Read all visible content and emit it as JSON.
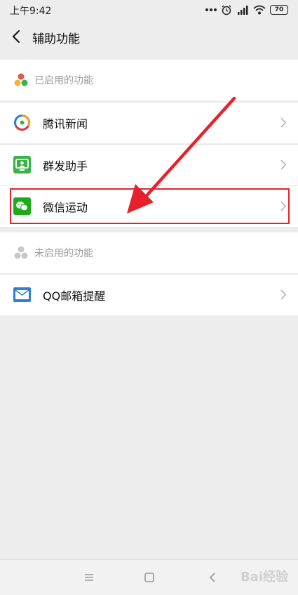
{
  "status_bar": {
    "time": "上午9:42",
    "battery": "70"
  },
  "nav": {
    "title": "辅助功能"
  },
  "enabled_section": {
    "label": "已启用的功能",
    "items": [
      {
        "label": "腾讯新闻",
        "icon": "tencent-news-icon"
      },
      {
        "label": "群发助手",
        "icon": "mass-message-icon"
      },
      {
        "label": "微信运动",
        "icon": "wechat-sports-icon"
      }
    ]
  },
  "disabled_section": {
    "label": "未启用的功能",
    "items": [
      {
        "label": "QQ邮箱提醒",
        "icon": "qq-mail-icon"
      }
    ]
  },
  "watermark": "Bai经验",
  "colors": {
    "highlight": "#e8202a",
    "wechat_green": "#1aad19",
    "mail_blue": "#2f7fd8"
  }
}
